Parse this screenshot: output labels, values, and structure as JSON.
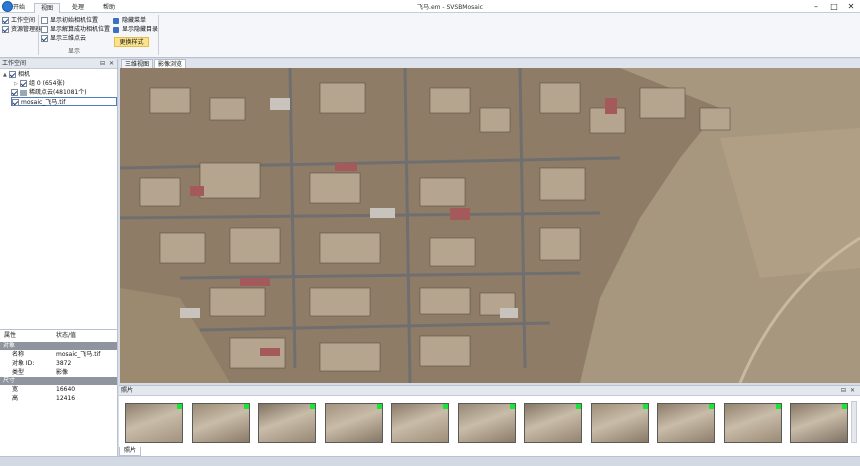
{
  "window": {
    "title": "飞马.em - SVSBMosaic",
    "minimize_glyph": "–",
    "maximize_glyph": "□",
    "close_glyph": "✕"
  },
  "ribbon": {
    "tabs": [
      "开始",
      "视图",
      "处理",
      "帮助"
    ],
    "active_tab": "视图",
    "panels_group": {
      "workspace": "工作空间",
      "resource_manager": "资源管理器"
    },
    "display_group": {
      "show_initial_camera": "显示初始相机位置",
      "show_adjusted_camera": "显示解算成功相机位置",
      "show_3d_points": "显示三维点云",
      "hide_menu": "隐藏菜单",
      "show_hidden_path": "显示隐藏目录",
      "change_style": "更换样式",
      "group_label": "显示"
    }
  },
  "workspace_panel": {
    "title": "工作空间",
    "tree": {
      "camera": "相机",
      "group": "组 0 (654张)",
      "sparse_points": "稀疏点云(481081个)",
      "mosaic": "mosaic_飞马.tif"
    }
  },
  "properties_panel": {
    "header_property": "属性",
    "header_value": "状态/值",
    "category_object": "对象",
    "category_size": "尺寸",
    "rows": [
      {
        "key": "名称",
        "value": "mosaic_飞马.tif"
      },
      {
        "key": "对象 ID:",
        "value": "3872"
      },
      {
        "key": "类型",
        "value": "影像"
      }
    ],
    "size_rows": [
      {
        "key": "宽",
        "value": "16640"
      },
      {
        "key": "高",
        "value": "12416"
      }
    ]
  },
  "view_tabs": [
    "三维视图",
    "影像浏览"
  ],
  "active_view_tab": "影像浏览",
  "photos_panel": {
    "title": "照片",
    "tab_label": "照片",
    "thumbnail_count": 11,
    "flag_color": "#17e637"
  },
  "pane_buttons": {
    "pin": "⊟",
    "close": "✕"
  },
  "colors": {
    "accent": "#2b78d3",
    "highlight_button": "#fbe38e",
    "category_bar": "#8e959e"
  }
}
